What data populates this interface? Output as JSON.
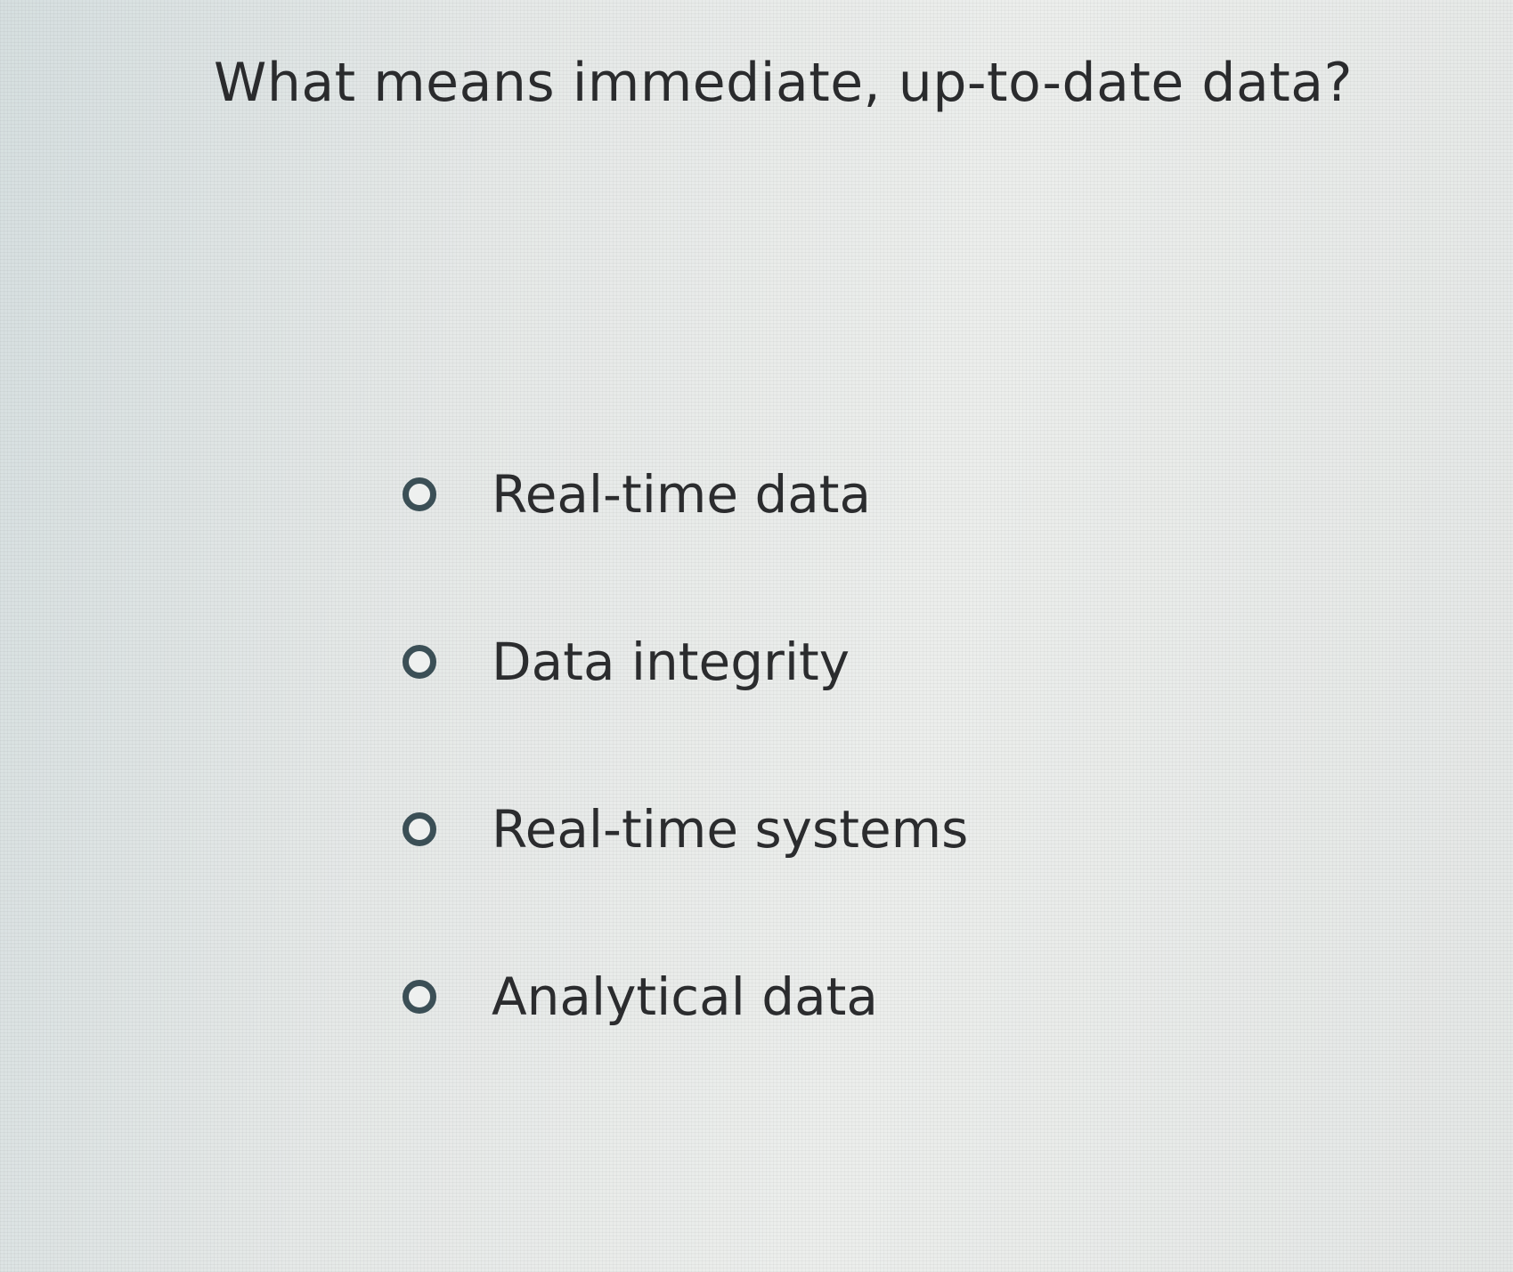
{
  "question": {
    "text": "What means immediate, up-to-date data?"
  },
  "options": [
    {
      "label": "Real-time data"
    },
    {
      "label": "Data integrity"
    },
    {
      "label": "Real-time systems"
    },
    {
      "label": "Analytical data"
    }
  ],
  "colors": {
    "radio_border": "#3b4f56",
    "text": "#2b2c2e",
    "background": "#e9eceb"
  }
}
